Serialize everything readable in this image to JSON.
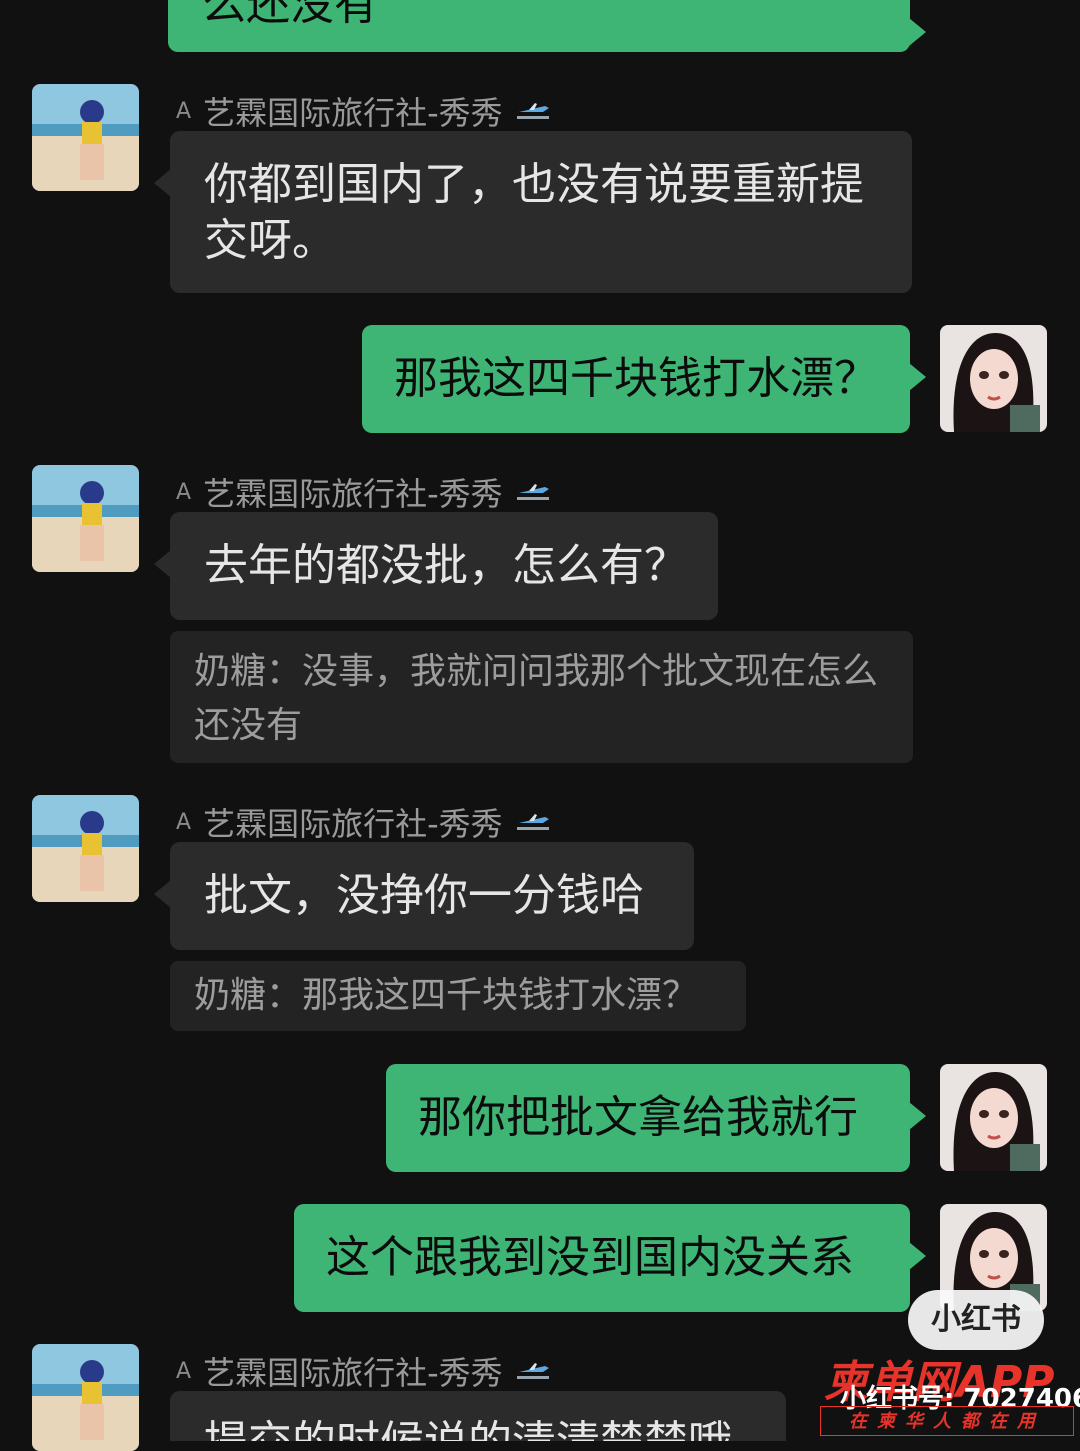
{
  "messages": {
    "m0_outgoing_partial": "么还没有",
    "m1_sender": "艺霖国际旅行社-秀秀",
    "m1_text": "你都到国内了，也没有说要重新提交呀。",
    "m2_outgoing": "那我这四千块钱打水漂？",
    "m3_sender": "艺霖国际旅行社-秀秀",
    "m3_text": "去年的都没批，怎么有？",
    "m3_quote": "奶糖：没事，我就问问我那个批文现在怎么还没有",
    "m4_sender": "艺霖国际旅行社-秀秀",
    "m4_text": "批文，没挣你一分钱哈",
    "m4_quote": "奶糖：那我这四千块钱打水漂？",
    "m5_outgoing": "那你把批文拿给我就行",
    "m6_outgoing": "这个跟我到没到国内没关系",
    "m7_sender": "艺霖国际旅行社-秀秀",
    "m7_text_partial": "提交的时候说的清清楚楚哦"
  },
  "sender_prefix": "A",
  "watermark": {
    "xiaohongshu": "小红书",
    "xhs_id": "小红书号: 7027406",
    "brand": "柬单网APP",
    "brand_sub": "在柬华人都在用"
  },
  "colors": {
    "background": "#111111",
    "outgoing_bubble": "#3eb575",
    "incoming_bubble": "#2b2b2b",
    "quote_bg": "#232323",
    "brand_red": "#e8332a"
  },
  "icons": {
    "plane": "airplane-emoji",
    "avatar_contact": "beach-photo-avatar",
    "avatar_self": "illustrated-girl-avatar"
  }
}
